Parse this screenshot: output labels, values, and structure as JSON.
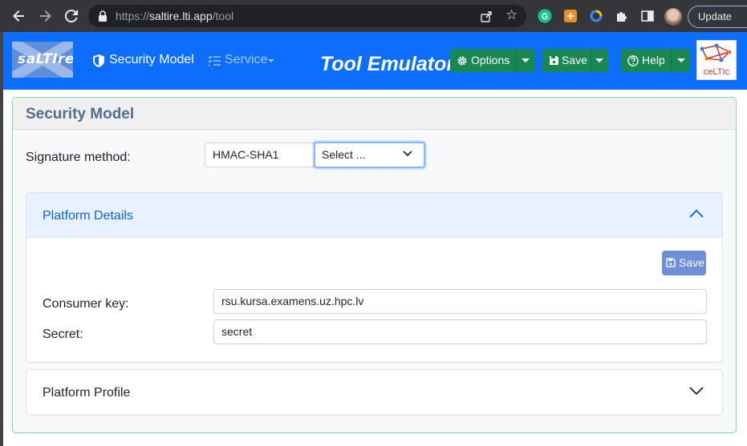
{
  "browser": {
    "url_host": "saltire.lti.app",
    "url_path": "/tool",
    "url_scheme": "https://",
    "update_label": "Update"
  },
  "navbar": {
    "logo_text": "saLTIre",
    "security_model_label": "Security Model",
    "service_label": "Service",
    "brand_title": "Tool Emulator",
    "options_label": "Options",
    "save_label": "Save",
    "help_label": "Help",
    "brand_color": "#0d6efd",
    "button_color": "#198754"
  },
  "card": {
    "title": "Security Model",
    "signature_method_label": "Signature method:",
    "signature_method_value": "HMAC-SHA1",
    "signature_select_value": "Select ...",
    "platform_details": {
      "title": "Platform Details",
      "save_label": "Save",
      "consumer_key_label": "Consumer key:",
      "consumer_key_value": "rsu.kursa.examens.uz.hpc.lv",
      "secret_label": "Secret:",
      "secret_value": "secret",
      "expanded": true
    },
    "platform_profile": {
      "title": "Platform Profile",
      "expanded": false
    }
  }
}
